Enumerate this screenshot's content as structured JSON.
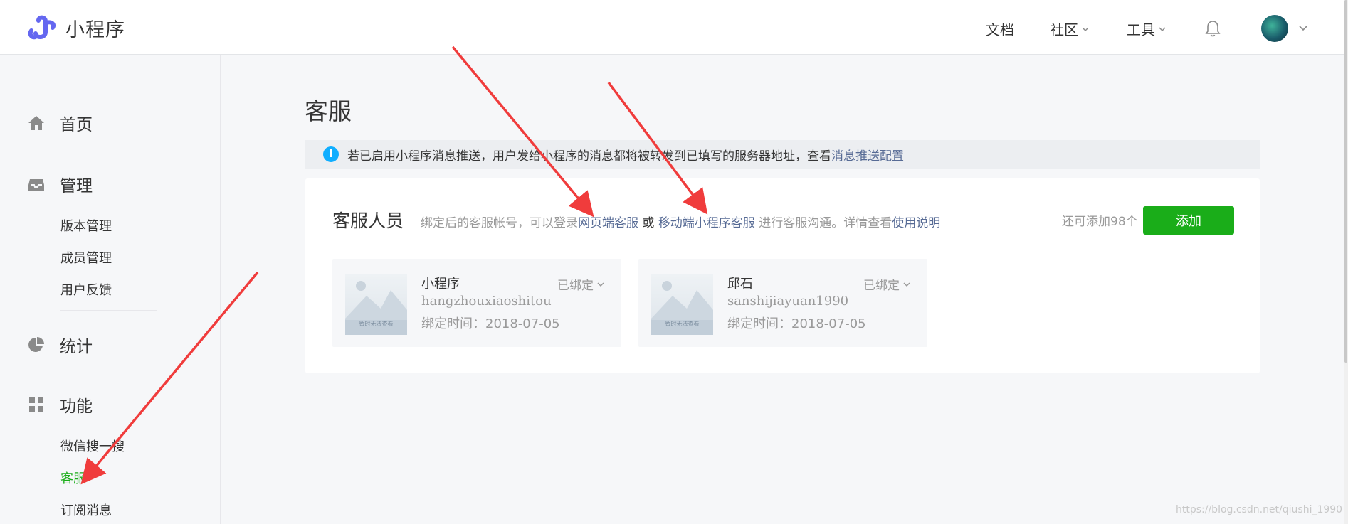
{
  "header": {
    "logo_text": "小程序",
    "nav": [
      {
        "label": "文档"
      },
      {
        "label": "社区"
      },
      {
        "label": "工具"
      }
    ]
  },
  "sidebar": {
    "groups": [
      {
        "label": "首页",
        "icon": "home-icon"
      },
      {
        "label": "管理",
        "icon": "inbox-icon"
      },
      {
        "label": "统计",
        "icon": "pie-chart-icon"
      },
      {
        "label": "功能",
        "icon": "grid-icon"
      }
    ],
    "manage_items": [
      "版本管理",
      "成员管理",
      "用户反馈"
    ],
    "feature_items": [
      "微信搜一搜",
      "客服",
      "订阅消息"
    ],
    "active_item": "客服"
  },
  "page": {
    "title": "客服",
    "notice": {
      "text": "若已启用小程序消息推送，用户发给小程序的消息都将被转发到已填写的服务器地址，查看",
      "link": "消息推送配置"
    }
  },
  "panel": {
    "title": "客服人员",
    "desc_prefix": "绑定后的客服帐号，可以登录",
    "link_web": "网页端客服",
    "or": "或",
    "link_mobile": "移动端小程序客服",
    "desc_mid": "进行客服沟通。详情查看",
    "link_help": "使用说明",
    "remaining": "还可添加98个",
    "add_button": "添加"
  },
  "agents": [
    {
      "name": "小程序",
      "account": "hangzhouxiaoshitou",
      "bind_time": "绑定时间：2018-07-05",
      "status": "已绑定",
      "thumb_caption": "暂时无法查看"
    },
    {
      "name": "邱石",
      "account": "sanshijiayuan1990",
      "bind_time": "绑定时间：2018-07-05",
      "status": "已绑定",
      "thumb_caption": "暂时无法查看"
    }
  ],
  "watermark": "https://blog.csdn.net/qiushi_1990",
  "colors": {
    "accent": "#1aad19",
    "link": "#576b95",
    "info": "#10aeff",
    "annotation": "#f03c3c"
  }
}
